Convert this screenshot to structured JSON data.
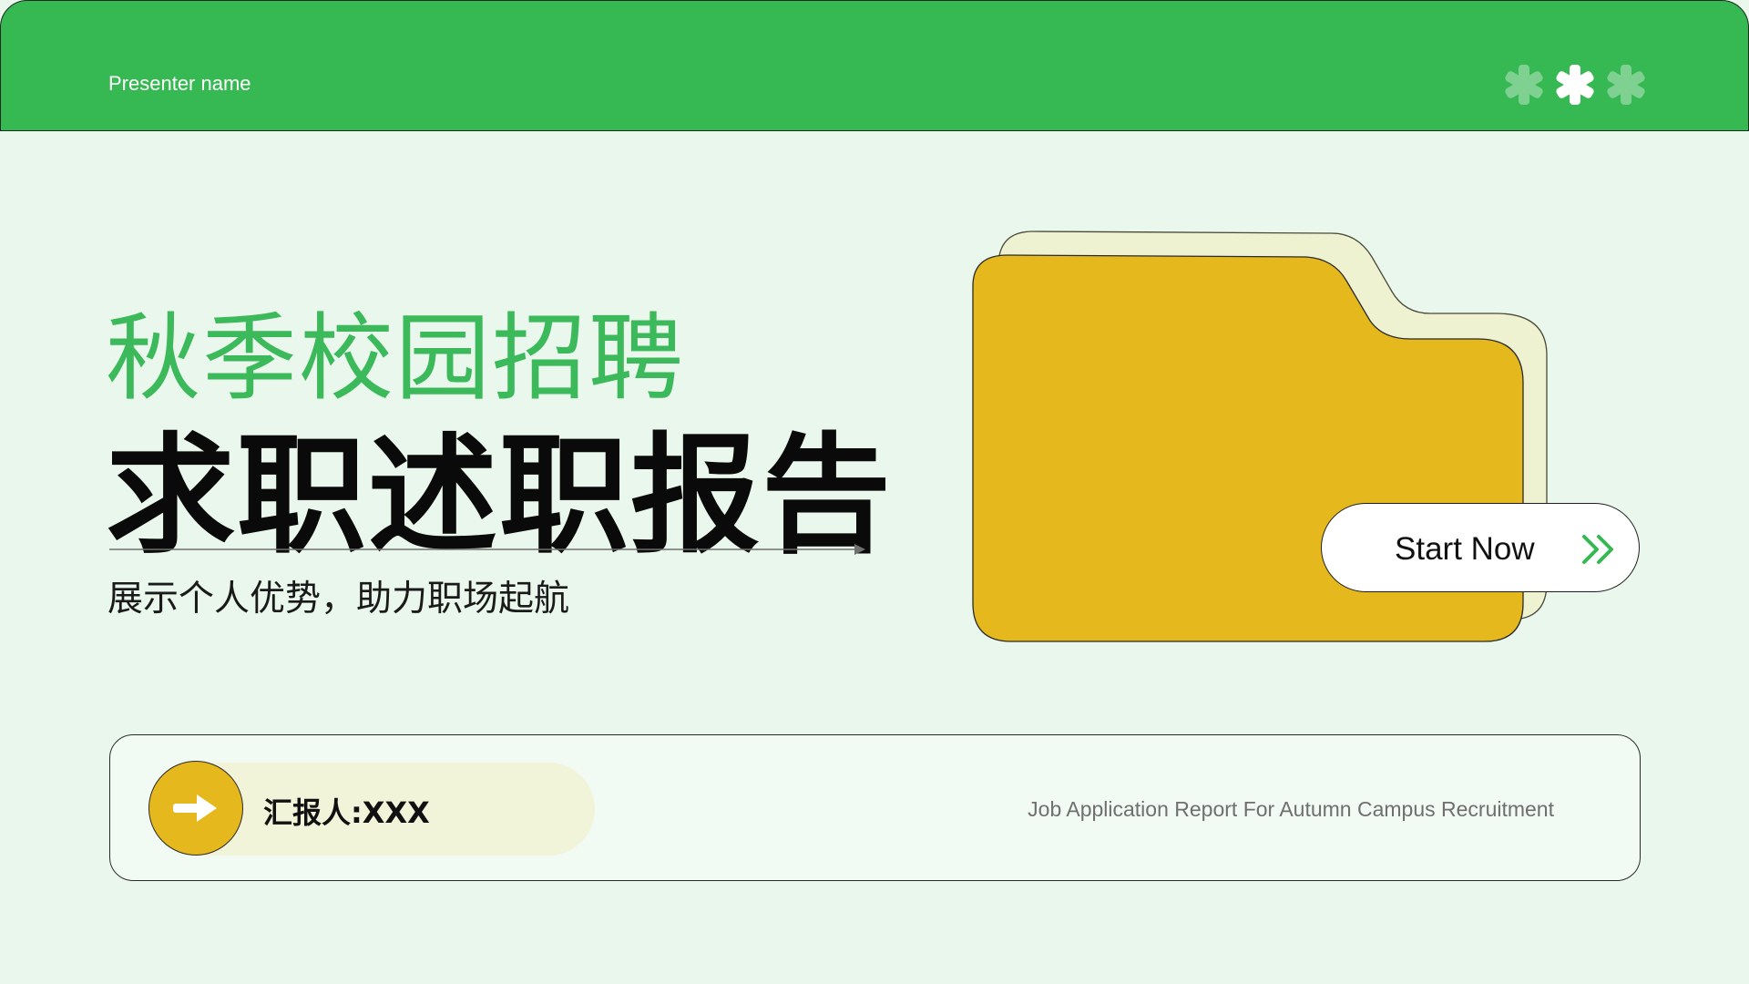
{
  "header": {
    "presenter": "Presenter name",
    "decor_icons": [
      "asterisk-icon",
      "asterisk-icon",
      "asterisk-icon"
    ]
  },
  "hero": {
    "subtitle": "秋季校园招聘",
    "title": "求职述职报告",
    "tagline": "展示个人优势，助力职场起航"
  },
  "cta": {
    "label": "Start Now",
    "icon": "double-chevron-right-icon"
  },
  "info": {
    "reporter": "汇报人:XXX",
    "english": "Job Application Report For Autumn Campus Recruitment",
    "icon": "arrow-right-icon"
  },
  "colors": {
    "green": "#36b852",
    "light_green_bg": "#eaf7ec",
    "folder_yellow": "#e5b91d",
    "folder_back": "#eef2d0"
  }
}
